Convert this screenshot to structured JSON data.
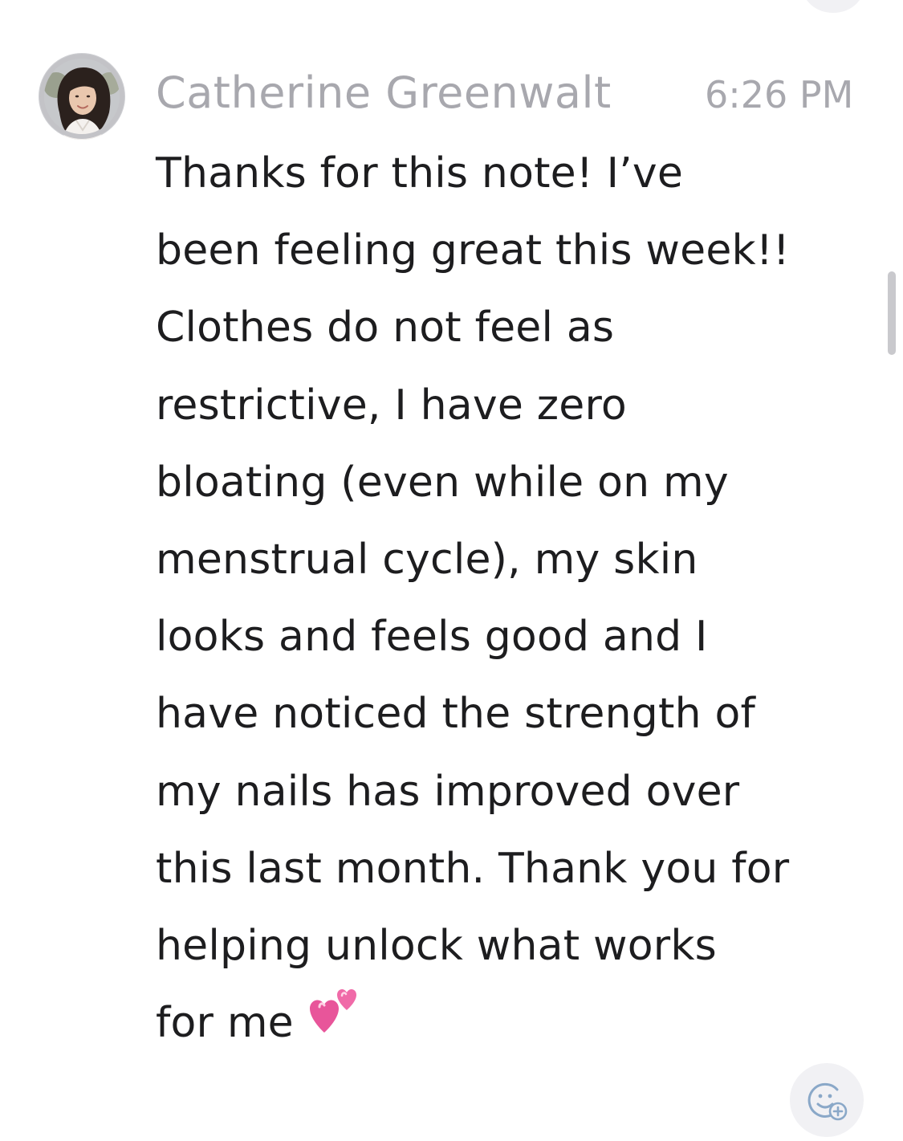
{
  "message": {
    "sender_name": "Catherine Greenwalt",
    "timestamp": "6:26 PM",
    "body_lines": [
      "Thanks for this note! I’ve",
      "been feeling great this week!!",
      "Clothes do not feel as",
      "restrictive, I have zero",
      "bloating (even while on my",
      "menstrual cycle), my skin",
      "looks and feels good and I",
      "have noticed the strength of",
      "my nails has improved over",
      "this last month. Thank you for",
      "helping unlock what works",
      "for me"
    ],
    "trailing_emoji": "two-hearts-emoji"
  },
  "icons": {
    "avatar": "avatar-photo",
    "reaction": "add-reaction-icon"
  },
  "colors": {
    "background": "#ffffff",
    "name_and_time": "#a8a8ae",
    "body_text": "#1d1d1f",
    "heart": "#e8559a",
    "reaction_button_bg": "#f1f1f4",
    "reaction_icon": "#8aa8c8",
    "scrollbar": "#c9c9cd"
  }
}
